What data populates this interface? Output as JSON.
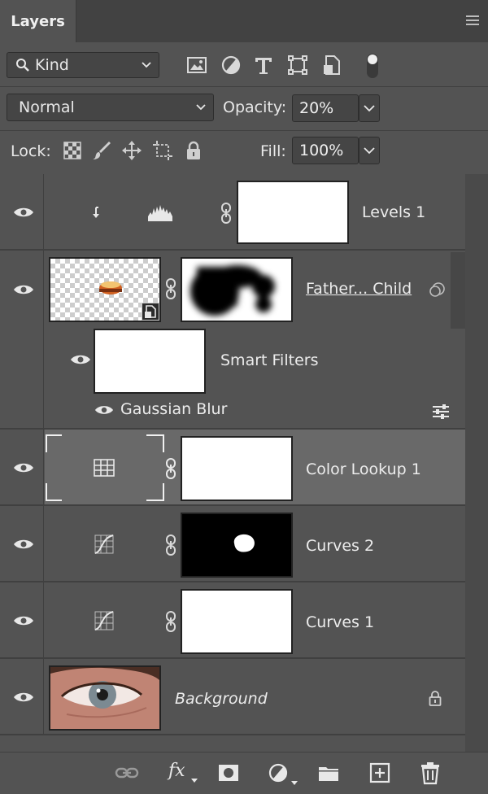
{
  "panel": {
    "tab_label": "Layers",
    "menu_icon": "hamburger-icon"
  },
  "filter": {
    "kind_label": "Kind",
    "icons": [
      "image-filter-icon",
      "adjustment-filter-icon",
      "type-filter-icon",
      "shape-filter-icon",
      "smart-object-filter-icon",
      "filter-toggle-icon"
    ]
  },
  "blend": {
    "mode": "Normal",
    "opacity_label": "Opacity:",
    "opacity_value": "20%"
  },
  "lock": {
    "label": "Lock:",
    "icons": [
      "lock-transparent-pixels-icon",
      "lock-image-pixels-icon",
      "lock-position-icon",
      "lock-artboard-icon",
      "lock-all-icon"
    ],
    "fill_label": "Fill:",
    "fill_value": "100%"
  },
  "layers": [
    {
      "name": "Levels 1",
      "type": "levels-adjustment",
      "clipped": true,
      "selected": false
    },
    {
      "name": "Father... Child",
      "type": "smart-object",
      "selected": false,
      "smart_filters_label": "Smart Filters",
      "filters": [
        {
          "name": "Gaussian Blur"
        }
      ]
    },
    {
      "name": "Color Lookup 1",
      "type": "color-lookup-adjustment",
      "selected": true
    },
    {
      "name": "Curves 2",
      "type": "curves-adjustment",
      "selected": false
    },
    {
      "name": "Curves 1",
      "type": "curves-adjustment",
      "selected": false
    },
    {
      "name": "Background",
      "type": "background",
      "locked": true,
      "selected": false
    }
  ],
  "footer": {
    "icons": [
      "link-layers-icon",
      "layer-style-fx-icon",
      "add-mask-icon",
      "new-adjustment-icon",
      "new-group-icon",
      "new-layer-icon",
      "delete-layer-icon"
    ],
    "fx_label": "fx"
  },
  "colors": {
    "panel_bg": "#535353",
    "header_bg": "#424242",
    "selected_row": "#696969",
    "text": "#e8e8e8"
  }
}
